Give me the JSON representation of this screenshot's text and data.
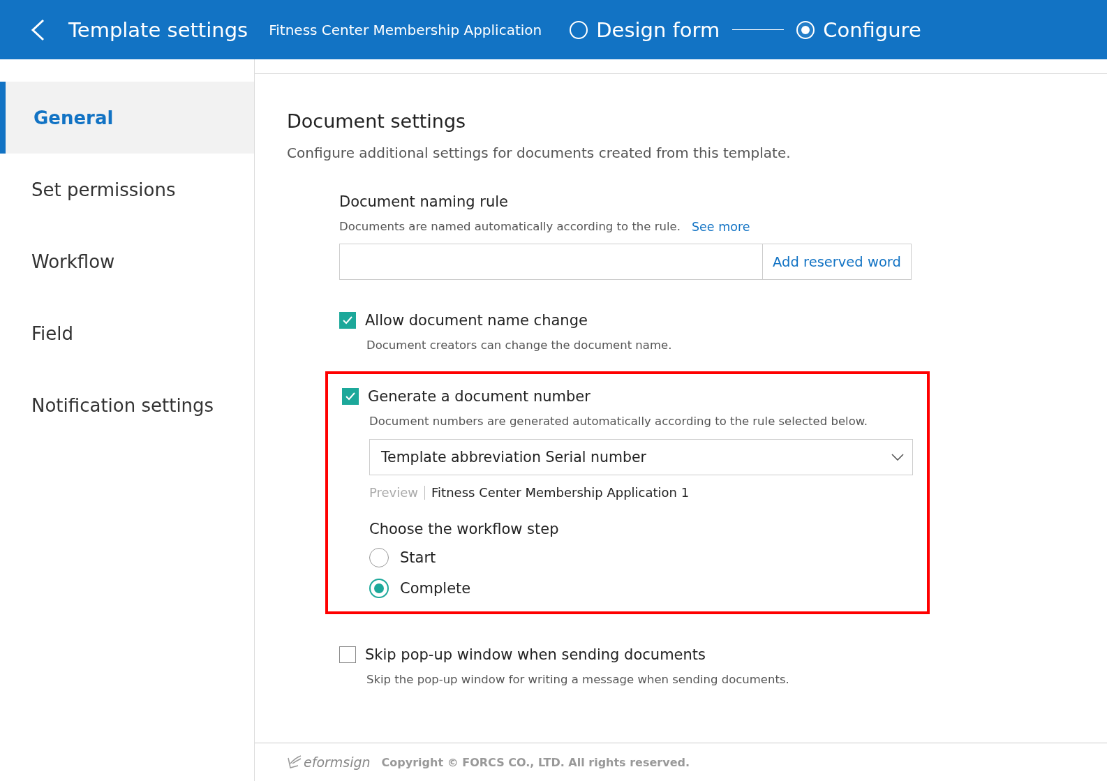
{
  "header": {
    "title": "Template settings",
    "form_name": "Fitness Center Membership Application",
    "steps": [
      {
        "label": "Design form",
        "selected": false
      },
      {
        "label": "Configure",
        "selected": true
      }
    ]
  },
  "sidebar": {
    "items": [
      {
        "label": "General",
        "selected": true
      },
      {
        "label": "Set permissions",
        "selected": false
      },
      {
        "label": "Workflow",
        "selected": false
      },
      {
        "label": "Field",
        "selected": false
      },
      {
        "label": "Notification settings",
        "selected": false
      }
    ]
  },
  "content": {
    "title": "Document settings",
    "description": "Configure additional settings for documents created from this template.",
    "naming_rule": {
      "label": "Document naming rule",
      "hint": "Documents are named automatically according to the rule.",
      "link": "See more",
      "button": "Add reserved word"
    },
    "allow_name_change": {
      "label": "Allow document name change",
      "checked": true,
      "hint": "Document creators can change the document name."
    },
    "document_number": {
      "highlighted": true,
      "label": "Generate a document number",
      "checked": true,
      "hint": "Document numbers are generated automatically according to the rule selected below.",
      "select_value": "Template abbreviation Serial number",
      "preview_label": "Preview",
      "preview_value": "Fitness Center Membership Application 1",
      "step_title": "Choose the workflow step",
      "options": [
        {
          "label": "Start",
          "selected": false
        },
        {
          "label": "Complete",
          "selected": true
        }
      ]
    },
    "skip_popup": {
      "label": "Skip pop-up window when sending documents",
      "checked": false,
      "hint": "Skip the pop-up window for writing a message when sending documents."
    }
  },
  "footer": {
    "logo": "eformsign",
    "copyright": "Copyright © FORCS CO., LTD. All rights reserved."
  }
}
